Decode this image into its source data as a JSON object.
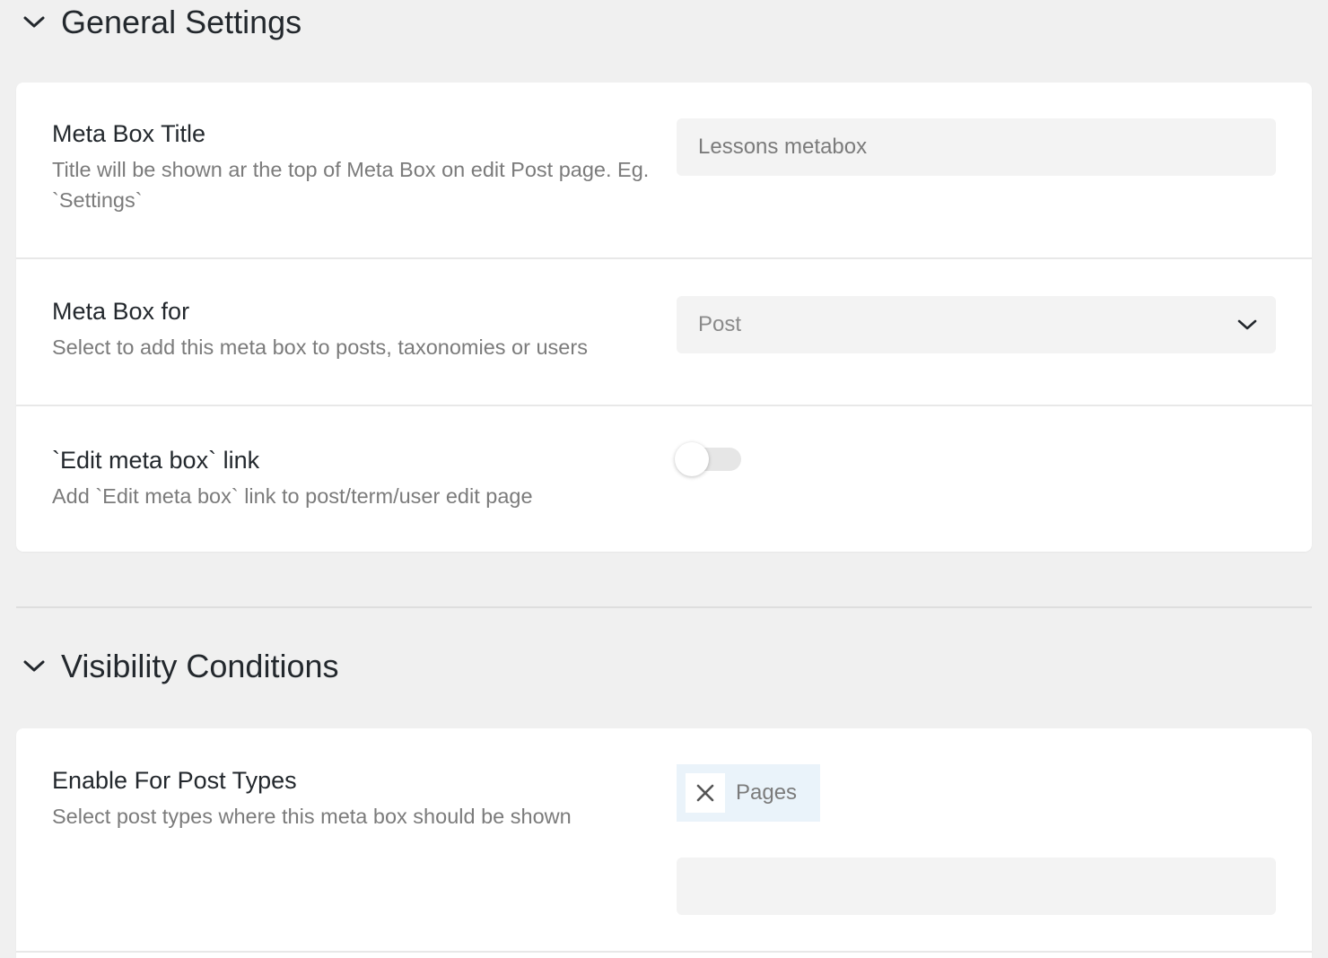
{
  "general": {
    "title": "General Settings",
    "meta_box_title": {
      "label": "Meta Box Title",
      "description": "Title will be shown ar the top of Meta Box on edit Post page. Eg. `Settings`",
      "value": "Lessons metabox"
    },
    "meta_box_for": {
      "label": "Meta Box for",
      "description": "Select to add this meta box to posts, taxonomies or users",
      "selected": "Post"
    },
    "edit_link": {
      "label": "`Edit meta box` link",
      "description": "Add `Edit meta box` link to post/term/user edit page",
      "enabled": false
    }
  },
  "visibility": {
    "title": "Visibility Conditions",
    "post_types": {
      "label": "Enable For Post Types",
      "description": "Select post types where this meta box should be shown",
      "selected_tags": [
        "Pages"
      ],
      "search_value": ""
    }
  },
  "icons": {
    "collapse": "chevron-down-icon",
    "select": "chevron-down-icon",
    "remove_tag": "close-icon"
  }
}
